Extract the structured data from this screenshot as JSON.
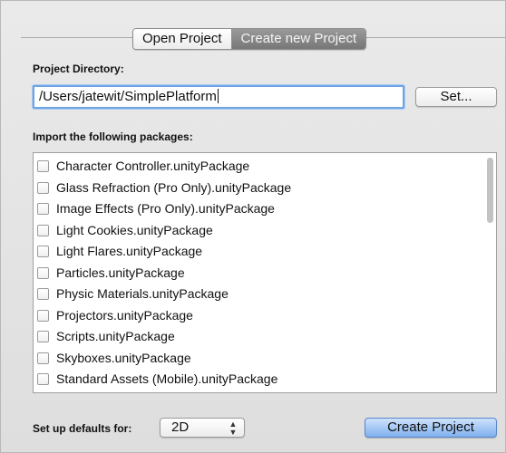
{
  "tabs": {
    "open": "Open Project",
    "create": "Create new Project",
    "active": "create"
  },
  "project_directory": {
    "label": "Project Directory:",
    "value": "/Users/jatewit/SimplePlatform",
    "set_button": "Set..."
  },
  "packages": {
    "label": "Import the following packages:",
    "items": [
      {
        "label": "Character Controller.unityPackage",
        "checked": false
      },
      {
        "label": "Glass Refraction (Pro Only).unityPackage",
        "checked": false
      },
      {
        "label": "Image Effects (Pro Only).unityPackage",
        "checked": false
      },
      {
        "label": "Light Cookies.unityPackage",
        "checked": false
      },
      {
        "label": "Light Flares.unityPackage",
        "checked": false
      },
      {
        "label": "Particles.unityPackage",
        "checked": false
      },
      {
        "label": "Physic Materials.unityPackage",
        "checked": false
      },
      {
        "label": "Projectors.unityPackage",
        "checked": false
      },
      {
        "label": "Scripts.unityPackage",
        "checked": false
      },
      {
        "label": "Skyboxes.unityPackage",
        "checked": false
      },
      {
        "label": "Standard Assets (Mobile).unityPackage",
        "checked": false
      }
    ]
  },
  "defaults": {
    "label": "Set up defaults for:",
    "selected": "2D",
    "arrows": "▲▼"
  },
  "create_button": "Create Project",
  "colors": {
    "accent": "#6ea4e6",
    "primary_button": "#7fb0f0",
    "active_tab": "#888888"
  }
}
